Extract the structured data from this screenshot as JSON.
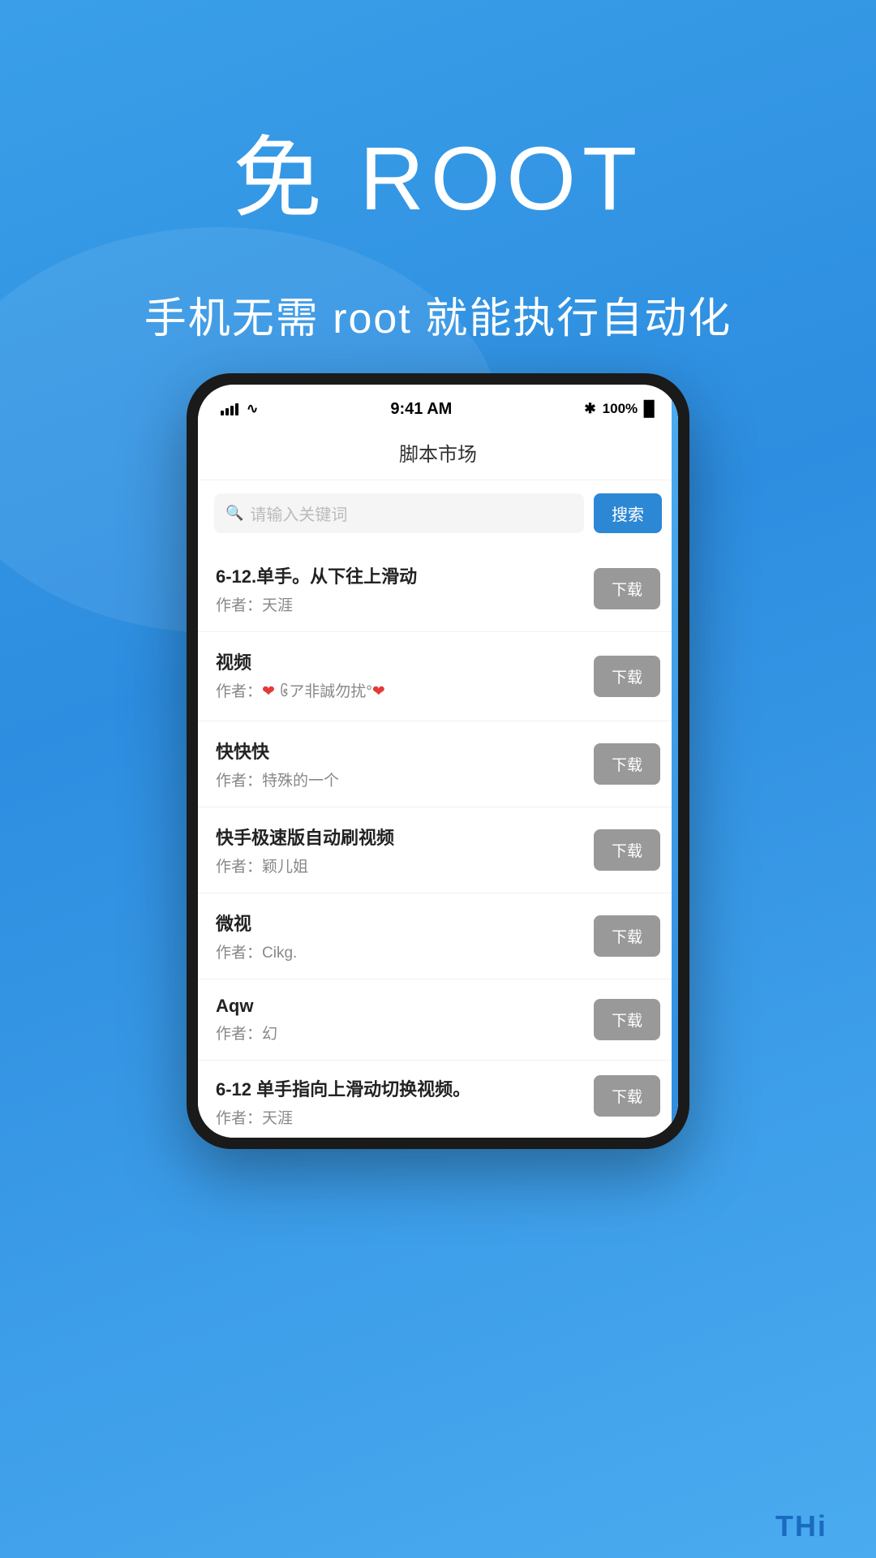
{
  "hero": {
    "title": "免 ROOT",
    "subtitle": "手机无需 root 就能执行自动化"
  },
  "phone": {
    "status_bar": {
      "time": "9:41 AM",
      "battery_pct": "100%",
      "bluetooth": "✱"
    },
    "app_header": {
      "title": "脚本市场"
    },
    "search": {
      "placeholder": "请输入关键词",
      "button_label": "搜索"
    },
    "scripts": [
      {
        "title": "6-12.单手。从下往上滑动",
        "author": "作者：天涯",
        "download_label": "下载"
      },
      {
        "title": "视频",
        "author": "作者：❤ ᪆ア非誠勿扰°❤",
        "download_label": "下载"
      },
      {
        "title": "快快快",
        "author": "作者：特殊的一个",
        "download_label": "下载"
      },
      {
        "title": "快手极速版自动刷视频",
        "author": "作者：颖儿姐",
        "download_label": "下载"
      },
      {
        "title": "微视",
        "author": "作者：Cikg.",
        "download_label": "下载"
      },
      {
        "title": "Aqw",
        "author": "作者：幻",
        "download_label": "下载"
      },
      {
        "title": "6-12 单手指向上滑动切换视频。",
        "author": "作者：天涯",
        "download_label": "下载",
        "partial": true
      }
    ]
  },
  "footer": {
    "text": "THi"
  }
}
